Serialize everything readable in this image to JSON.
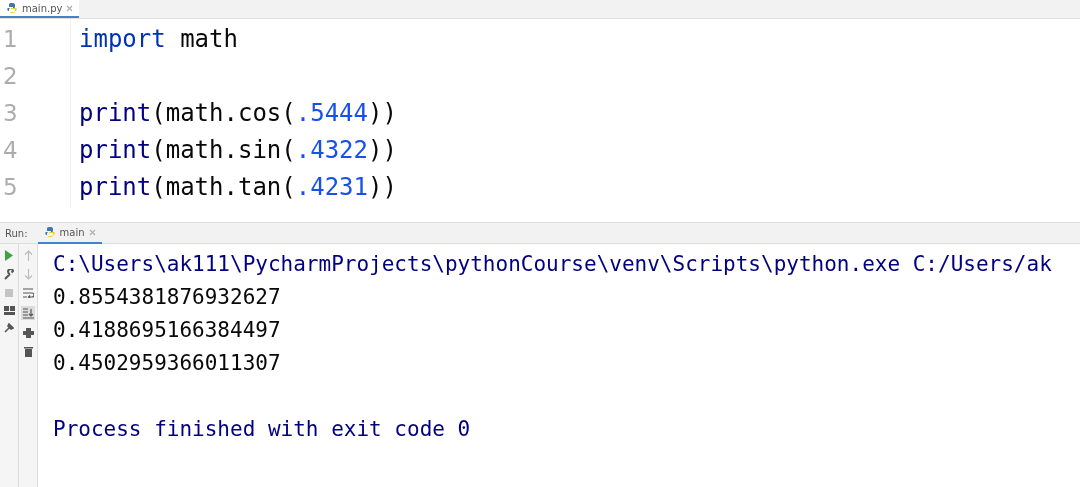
{
  "editor_tabs": [
    {
      "label": "main.py",
      "selected": true
    }
  ],
  "editor_lines": [
    {
      "number": "1",
      "tokens": [
        {
          "text": "import",
          "kind": "keyword"
        },
        {
          "text": " math",
          "kind": "plain"
        }
      ]
    },
    {
      "number": "2"
    },
    {
      "number": "3",
      "tokens": [
        {
          "text": "print",
          "kind": "builtin"
        },
        {
          "text": "(math.cos(",
          "kind": "plain"
        },
        {
          "text": ".5444",
          "kind": "number"
        },
        {
          "text": "))",
          "kind": "plain"
        }
      ]
    },
    {
      "number": "4",
      "tokens": [
        {
          "text": "print",
          "kind": "builtin"
        },
        {
          "text": "(math.sin(",
          "kind": "plain"
        },
        {
          "text": ".4322",
          "kind": "number"
        },
        {
          "text": "))",
          "kind": "plain"
        }
      ]
    },
    {
      "number": "5",
      "tokens": [
        {
          "text": "print",
          "kind": "builtin"
        },
        {
          "text": "(math.tan(",
          "kind": "plain"
        },
        {
          "text": ".4231",
          "kind": "number"
        },
        {
          "text": "))",
          "kind": "plain"
        }
      ]
    }
  ],
  "run_panel": {
    "label": "Run:",
    "tab": "main",
    "scroll_to_end_on": true
  },
  "console_lines": [
    {
      "text": "C:\\Users\\ak111\\PycharmProjects\\pythonCourse\\venv\\Scripts\\python.exe C:/Users/ak",
      "kind": "command"
    },
    {
      "text": "0.8554381876932627",
      "kind": "output"
    },
    {
      "text": "0.4188695166384497",
      "kind": "output"
    },
    {
      "text": "0.4502959366011307",
      "kind": "output"
    },
    {
      "text": "Process finished with exit code 0",
      "kind": "status"
    }
  ]
}
